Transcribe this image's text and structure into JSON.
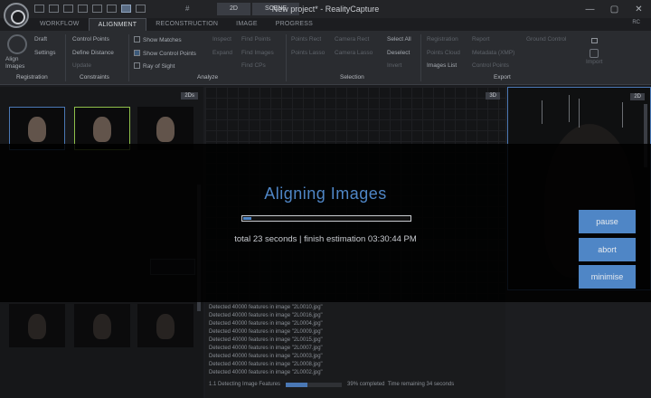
{
  "window": {
    "title": "New project* - RealityCapture",
    "title_hash": "#",
    "view_tabs": [
      "2D",
      "SCENE",
      "IMAGE",
      "PROGRESS"
    ],
    "controls": [
      "—",
      "▢",
      "✕"
    ],
    "user_badge": "RC"
  },
  "ribbon_tabs": [
    "WORKFLOW",
    "ALIGNMENT",
    "RECONSTRUCTION",
    "IMAGE",
    "PROGRESS"
  ],
  "ribbon": {
    "align_images": "Align Images",
    "draft": "Draft",
    "settings": "Settings",
    "control_points": "Control Points",
    "define_distance": "Define Distance",
    "update": "Update",
    "show_matches": "Show Matches",
    "show_control_points": "Show Control Points",
    "ray_of_sight": "Ray of Sight",
    "inspect": "Inspect",
    "expand": "Expand",
    "find_points": "Find Points",
    "find_images": "Find Images",
    "find_cps": "Find CPs",
    "points_rect": "Points Rect",
    "points_lasso": "Points Lasso",
    "camera_rect": "Camera Rect",
    "camera_lasso": "Camera Lasso",
    "select_all": "Select All",
    "deselect": "Deselect",
    "invert": "Invert",
    "registration": "Registration",
    "points_cloud": "Points Cloud",
    "images_list": "Images List",
    "report": "Report",
    "metadata_xmp": "Metadata (XMP)",
    "control_points_export": "Control Points",
    "ground_control": "Ground Control",
    "import": "Import",
    "groups": {
      "registration": "Registration",
      "constraints": "Constraints",
      "analyze": "Analyze",
      "selection": "Selection",
      "export": "Export"
    }
  },
  "panels": {
    "left_tag": "2Ds",
    "center_tag": "3D",
    "right_tag": "2D"
  },
  "console": {
    "lines": [
      "Detected 40000 features in image \"2L0010.jpg\"",
      "Detected 40000 features in image \"2L0016.jpg\"",
      "Detected 40000 features in image \"2L0004.jpg\"",
      "Detected 40000 features in image \"2L0009.jpg\"",
      "Detected 40000 features in image \"2L0015.jpg\"",
      "Detected 40000 features in image \"2L0007.jpg\"",
      "Detected 40000 features in image \"2L0003.jpg\"",
      "Detected 40000 features in image \"2L0008.jpg\"",
      "Detected 40000 features in image \"2L0002.jpg\""
    ],
    "status_label": "1.1 Detecting Image Features",
    "status_pct": "39% completed",
    "status_remaining": "Time remaining 34 seconds",
    "status_progress": 0.39
  },
  "progress_overlay": {
    "title": "Aligning Images",
    "subtitle": "total 23 seconds | finish estimation 03:30:44 PM",
    "progress": 0.05,
    "pause": "pause",
    "abort": "abort",
    "minimise": "minimise"
  }
}
